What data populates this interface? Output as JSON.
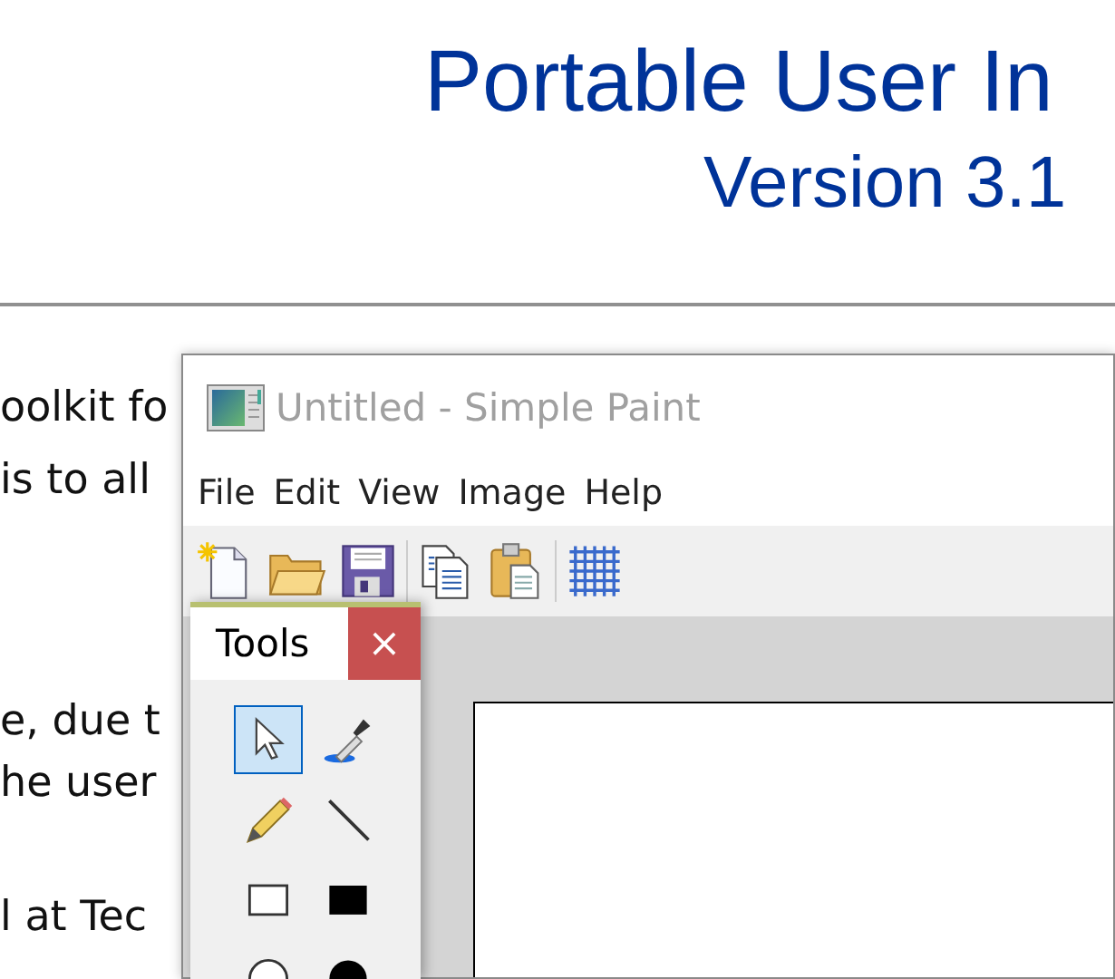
{
  "document": {
    "title": "Portable User In",
    "subtitle": "Version 3.1",
    "lines": [
      "oolkit fo",
      "is to all",
      "e, due t",
      "he user",
      "l at Tec"
    ]
  },
  "paint_window": {
    "title": "Untitled - Simple Paint",
    "active": false,
    "menu": [
      "File",
      "Edit",
      "View",
      "Image",
      "Help"
    ],
    "toolbar_groups": [
      [
        {
          "kind": "new"
        },
        {
          "kind": "open"
        },
        {
          "kind": "save"
        }
      ],
      [
        {
          "kind": "copy"
        },
        {
          "kind": "paste"
        }
      ],
      [
        {
          "kind": "grid"
        }
      ]
    ]
  },
  "tools_palette": {
    "title": "Tools",
    "close": "×",
    "tools": [
      {
        "kind": "pointer",
        "selected": true
      },
      {
        "kind": "eyedropper",
        "selected": false
      },
      {
        "kind": "pencil",
        "selected": false
      },
      {
        "kind": "line",
        "selected": false
      },
      {
        "kind": "rectangle",
        "selected": false
      },
      {
        "kind": "filled-rectangle",
        "selected": false
      },
      {
        "kind": "ellipse",
        "selected": false
      },
      {
        "kind": "filled-ellipse",
        "selected": false
      }
    ]
  }
}
